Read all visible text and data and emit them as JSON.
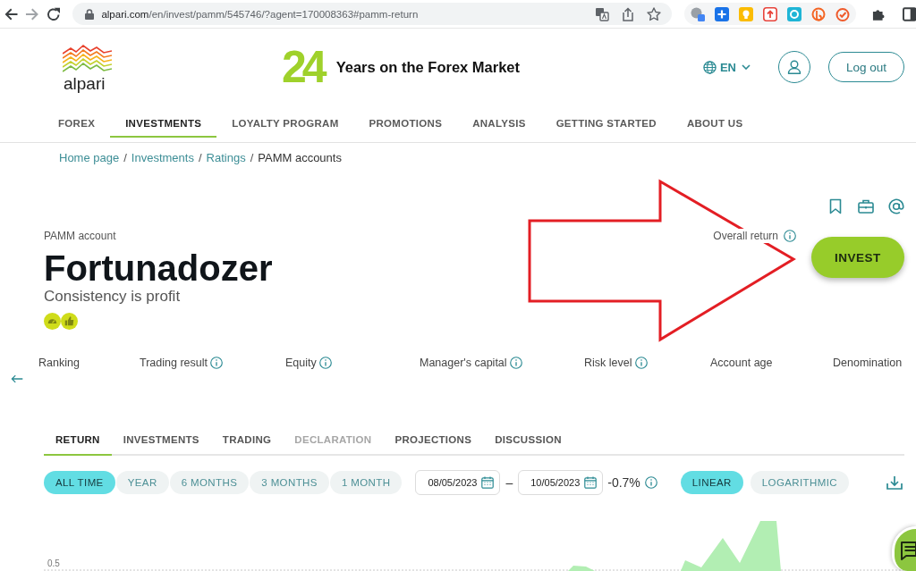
{
  "browser": {
    "url_host": "alpari.com",
    "url_path": "/en/invest/pamm/545746/?agent=170008363#pamm-return"
  },
  "header": {
    "logo_text": "alpari",
    "anniversary_number": "24",
    "anniversary_text": "Years on the Forex Market",
    "language": "EN",
    "logout": "Log out"
  },
  "nav": [
    {
      "label": "FOREX",
      "selected": false
    },
    {
      "label": "INVESTMENTS",
      "selected": true
    },
    {
      "label": "LOYALTY PROGRAM",
      "selected": false
    },
    {
      "label": "PROMOTIONS",
      "selected": false
    },
    {
      "label": "ANALYSIS",
      "selected": false
    },
    {
      "label": "GETTING STARTED",
      "selected": false
    },
    {
      "label": "ABOUT US",
      "selected": false
    }
  ],
  "breadcrumb": [
    {
      "label": "Home page",
      "current": false,
      "separator": "/"
    },
    {
      "label": "Investments",
      "current": false,
      "separator": "/"
    },
    {
      "label": "Ratings",
      "current": false,
      "separator": "/"
    },
    {
      "label": "PAMM accounts",
      "current": true
    }
  ],
  "account": {
    "type_label": "PAMM account",
    "name": "Fortunadozer",
    "motto": "Consistency is profit",
    "overall_return_label": "Overall return",
    "invest_button": "INVEST"
  },
  "metrics": [
    {
      "label": "Ranking",
      "info": false
    },
    {
      "label": "Trading result",
      "info": true
    },
    {
      "label": "Equity",
      "info": true
    },
    {
      "label": "Manager's capital",
      "info": true
    },
    {
      "label": "Risk level",
      "info": true
    },
    {
      "label": "Account age",
      "info": false
    },
    {
      "label": "Denomination",
      "info": false
    }
  ],
  "tabs": [
    {
      "label": "RETURN",
      "selected": true,
      "disabled": false
    },
    {
      "label": "INVESTMENTS",
      "selected": false,
      "disabled": false
    },
    {
      "label": "TRADING",
      "selected": false,
      "disabled": false
    },
    {
      "label": "DECLARATION",
      "selected": false,
      "disabled": true
    },
    {
      "label": "PROJECTIONS",
      "selected": false,
      "disabled": false
    },
    {
      "label": "DISCUSSION",
      "selected": false,
      "disabled": false
    }
  ],
  "periods": [
    {
      "label": "ALL TIME",
      "selected": true
    },
    {
      "label": "YEAR",
      "selected": false
    },
    {
      "label": "6 MONTHS",
      "selected": false
    },
    {
      "label": "3 MONTHS",
      "selected": false
    },
    {
      "label": "1 MONTH",
      "selected": false
    }
  ],
  "date_range": {
    "from": "08/05/2023",
    "separator": "–",
    "to": "10/05/2023",
    "change": "-0.7%"
  },
  "scales": [
    {
      "label": "LINEAR",
      "selected": true
    },
    {
      "label": "LOGARITHMIC",
      "selected": false
    }
  ],
  "chart": {
    "y_tick": "0.5"
  }
}
